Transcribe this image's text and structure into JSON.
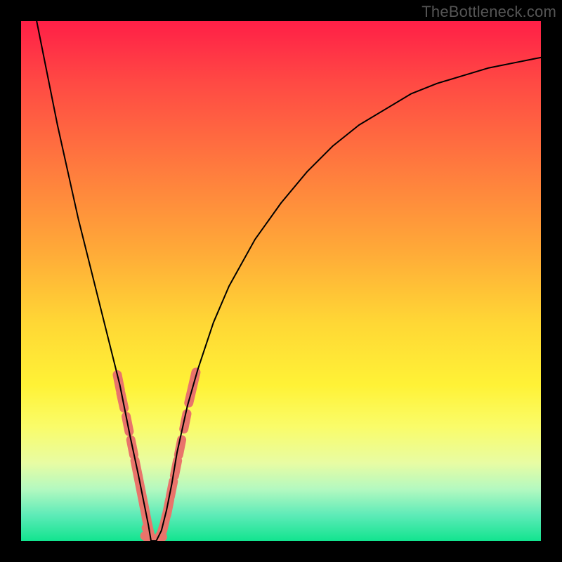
{
  "watermark": "TheBottleneck.com",
  "colors": {
    "curve": "#000000",
    "markers": "#e9746b",
    "frame": "#000000"
  },
  "chart_data": {
    "type": "line",
    "title": "",
    "xlabel": "",
    "ylabel": "",
    "xlim": [
      0,
      100
    ],
    "ylim": [
      0,
      100
    ],
    "grid": false,
    "series": [
      {
        "name": "bottleneck-curve",
        "x": [
          3,
          5,
          7,
          9,
          11,
          13,
          15,
          17,
          19,
          21,
          22.5,
          23.5,
          24.5,
          25,
          26,
          27,
          28,
          29,
          30,
          32,
          34,
          37,
          40,
          45,
          50,
          55,
          60,
          65,
          70,
          75,
          80,
          85,
          90,
          95,
          100
        ],
        "y": [
          100,
          90,
          80,
          71,
          62,
          54,
          46,
          38,
          30,
          20,
          13,
          8,
          3,
          0,
          0,
          2,
          6,
          11,
          17,
          26,
          33,
          42,
          49,
          58,
          65,
          71,
          76,
          80,
          83,
          86,
          88,
          89.5,
          91,
          92,
          93
        ]
      }
    ],
    "markers": {
      "name": "highlighted-points",
      "points": [
        {
          "x": 18.8,
          "y": 30.5
        },
        {
          "x": 19.5,
          "y": 27
        },
        {
          "x": 20.5,
          "y": 22.5
        },
        {
          "x": 21.4,
          "y": 18
        },
        {
          "x": 22.2,
          "y": 14
        },
        {
          "x": 22.8,
          "y": 11
        },
        {
          "x": 23.4,
          "y": 8
        },
        {
          "x": 23.9,
          "y": 5.5
        },
        {
          "x": 24.4,
          "y": 3
        },
        {
          "x": 24.8,
          "y": 1.2
        },
        {
          "x": 25.2,
          "y": 0.5
        },
        {
          "x": 25.8,
          "y": 0.3
        },
        {
          "x": 26.4,
          "y": 0.5
        },
        {
          "x": 27,
          "y": 1.5
        },
        {
          "x": 27.6,
          "y": 3.5
        },
        {
          "x": 28.3,
          "y": 6.5
        },
        {
          "x": 29,
          "y": 10
        },
        {
          "x": 29.8,
          "y": 14
        },
        {
          "x": 30.6,
          "y": 18
        },
        {
          "x": 31.6,
          "y": 23
        },
        {
          "x": 32.6,
          "y": 28
        },
        {
          "x": 33.3,
          "y": 31
        }
      ]
    }
  }
}
